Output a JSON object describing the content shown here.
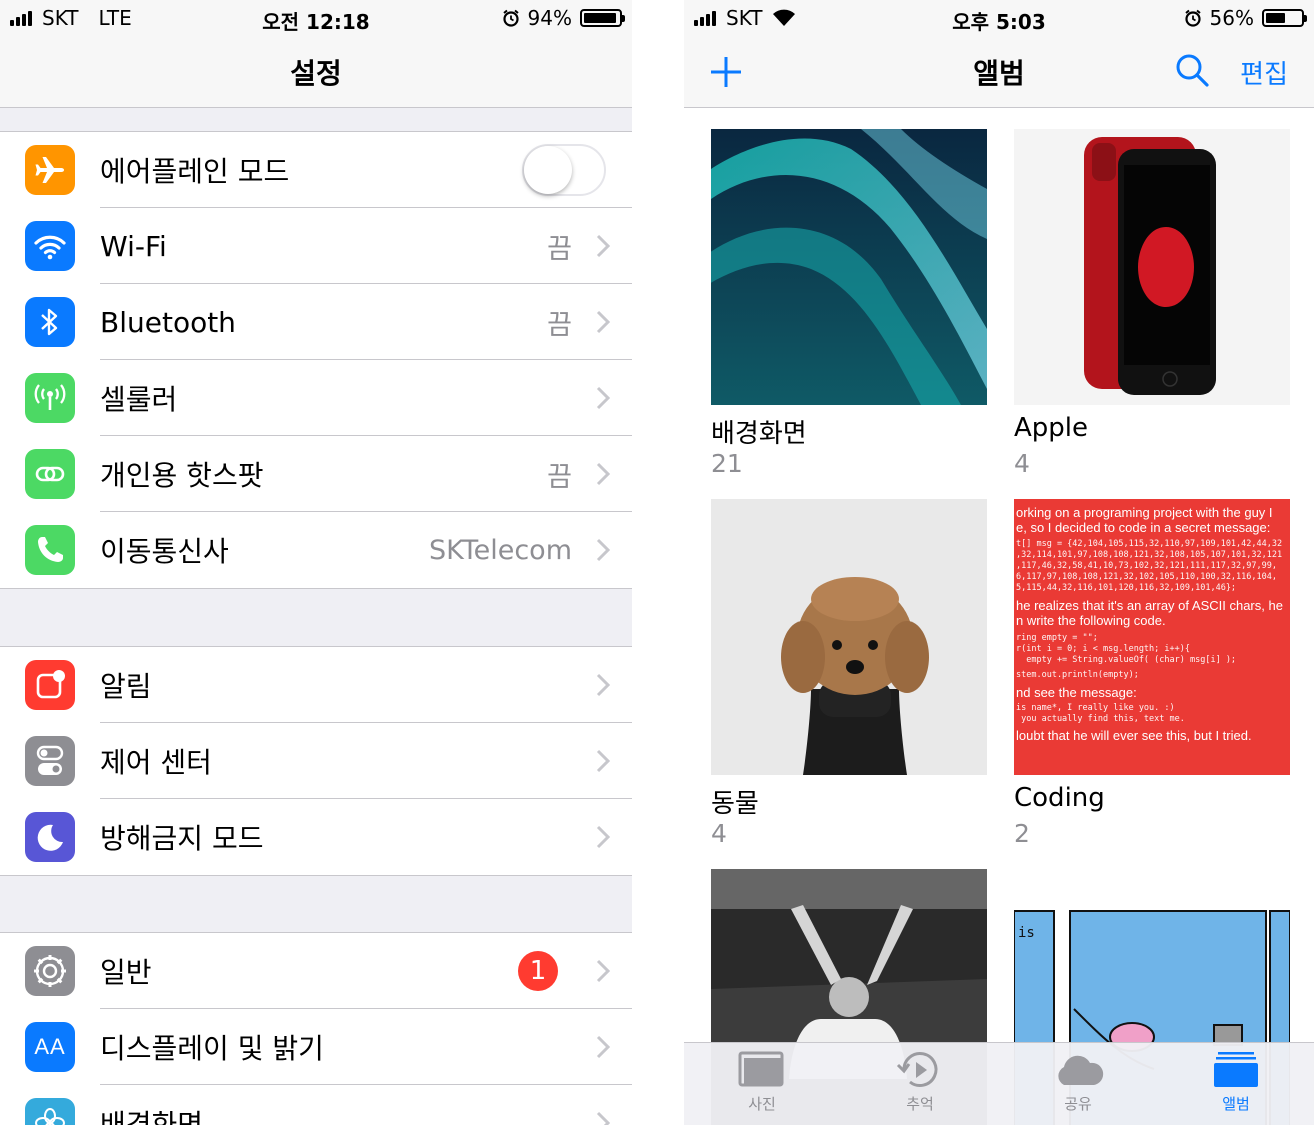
{
  "left_status": {
    "carrier": "SKT",
    "network": "LTE",
    "time": "오전 12:18",
    "battery": "94%",
    "battery_level": 0.94
  },
  "right_status": {
    "carrier": "SKT",
    "time": "오후 5:03",
    "battery": "56%",
    "battery_level": 0.56
  },
  "settings": {
    "title": "설정",
    "groups": [
      [
        {
          "label": "에어플레인 모드",
          "icon": "airplane-icon",
          "color": "#ff9500",
          "toggle": "off"
        },
        {
          "label": "Wi-Fi",
          "icon": "wifi-icon",
          "color": "#0a7aff",
          "value": "끔"
        },
        {
          "label": "Bluetooth",
          "icon": "bluetooth-icon",
          "color": "#0a7aff",
          "value": "끔"
        },
        {
          "label": "셀룰러",
          "icon": "cellular-icon",
          "color": "#4cd964",
          "value": ""
        },
        {
          "label": "개인용 핫스팟",
          "icon": "hotspot-icon",
          "color": "#4cd964",
          "value": "끔"
        },
        {
          "label": "이동통신사",
          "icon": "phone-icon",
          "color": "#4cd964",
          "value": "SKTelecom"
        }
      ],
      [
        {
          "label": "알림",
          "icon": "notifications-icon",
          "color": "#ff3b30"
        },
        {
          "label": "제어 센터",
          "icon": "control-center-icon",
          "color": "#8e8e93"
        },
        {
          "label": "방해금지 모드",
          "icon": "moon-icon",
          "color": "#5856d6"
        }
      ],
      [
        {
          "label": "일반",
          "icon": "gear-icon",
          "color": "#8e8e93",
          "badge": "1"
        },
        {
          "label": "디스플레이 및 밝기",
          "icon": "display-icon",
          "color": "#0a7aff"
        },
        {
          "label": "배경화면",
          "icon": "wallpaper-icon",
          "color": "#34aadc"
        }
      ]
    ]
  },
  "photos": {
    "title": "앨범",
    "edit_label": "편집",
    "albums": [
      {
        "name": "배경화면",
        "count": "21"
      },
      {
        "name": "Apple",
        "count": "4"
      },
      {
        "name": "동물",
        "count": "4"
      },
      {
        "name": "Coding",
        "count": "2"
      },
      {
        "name": "",
        "count": ""
      },
      {
        "name": "",
        "count": ""
      }
    ],
    "coding_note": {
      "line1": "orking on a programing project with the guy I",
      "line2": "e, so I decided to code in a secret message:",
      "code1": "t[] msg = {42,104,105,115,32,110,97,109,101,42,44,32",
      "code2": ",32,114,101,97,108,108,121,32,108,105,107,101,32,121",
      "code3": ",117,46,32,58,41,10,73,102,32,121,111,117,32,97,99,",
      "code4": "6,117,97,108,108,121,32,102,105,110,100,32,116,104,",
      "code5": "5,115,44,32,116,101,120,116,32,109,101,46};",
      "line3": "he realizes that it's an array of ASCII chars, he",
      "line4": "n write the following code.",
      "code6": "ring empty = \"\";",
      "code7": "r(int i = 0; i < msg.length; i++){",
      "code8": "  empty += String.valueOf( (char) msg[i] );",
      "code9": "stem.out.println(empty);",
      "line5": "nd see the message:",
      "code10": "is name*, I really like you. :)",
      "code11": " you actually find this, text me.",
      "line6": "loubt that he will ever see this, but I tried."
    },
    "tabs": [
      {
        "label": "사진",
        "icon": "photos-tab-icon"
      },
      {
        "label": "추억",
        "icon": "memories-tab-icon"
      },
      {
        "label": "공유",
        "icon": "shared-tab-icon"
      },
      {
        "label": "앨범",
        "icon": "albums-tab-icon",
        "active": true
      }
    ]
  },
  "colors": {
    "ios_blue": "#0a7aff",
    "separator": "#c8c7cc",
    "group_bg": "#efeff4",
    "coding_red": "#ea3a35"
  }
}
